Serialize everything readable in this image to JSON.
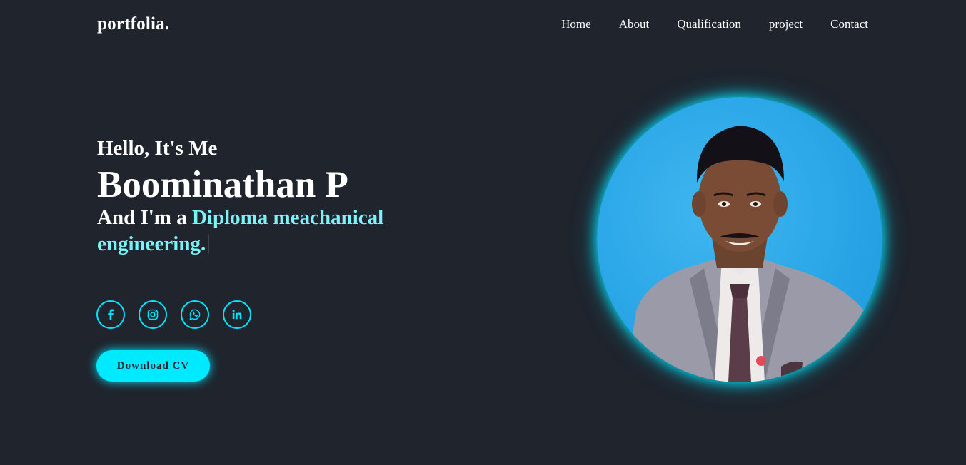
{
  "header": {
    "logo": "portfolia.",
    "nav": [
      "Home",
      "About",
      "Qualification",
      "project",
      "Contact"
    ]
  },
  "hero": {
    "greeting": "Hello, It's Me",
    "name": "Boominathan P",
    "role_prefix": "And I'm a ",
    "role_accent": "Diploma meachanical engineering."
  },
  "socials": [
    {
      "icon": "facebook-icon"
    },
    {
      "icon": "instagram-icon"
    },
    {
      "icon": "whatsapp-icon"
    },
    {
      "icon": "linkedin-icon"
    }
  ],
  "cta": {
    "download_label": "Download CV"
  },
  "colors": {
    "background": "#1f242d",
    "accent": "#00e5ff",
    "accent_text": "#7cf2f6"
  }
}
